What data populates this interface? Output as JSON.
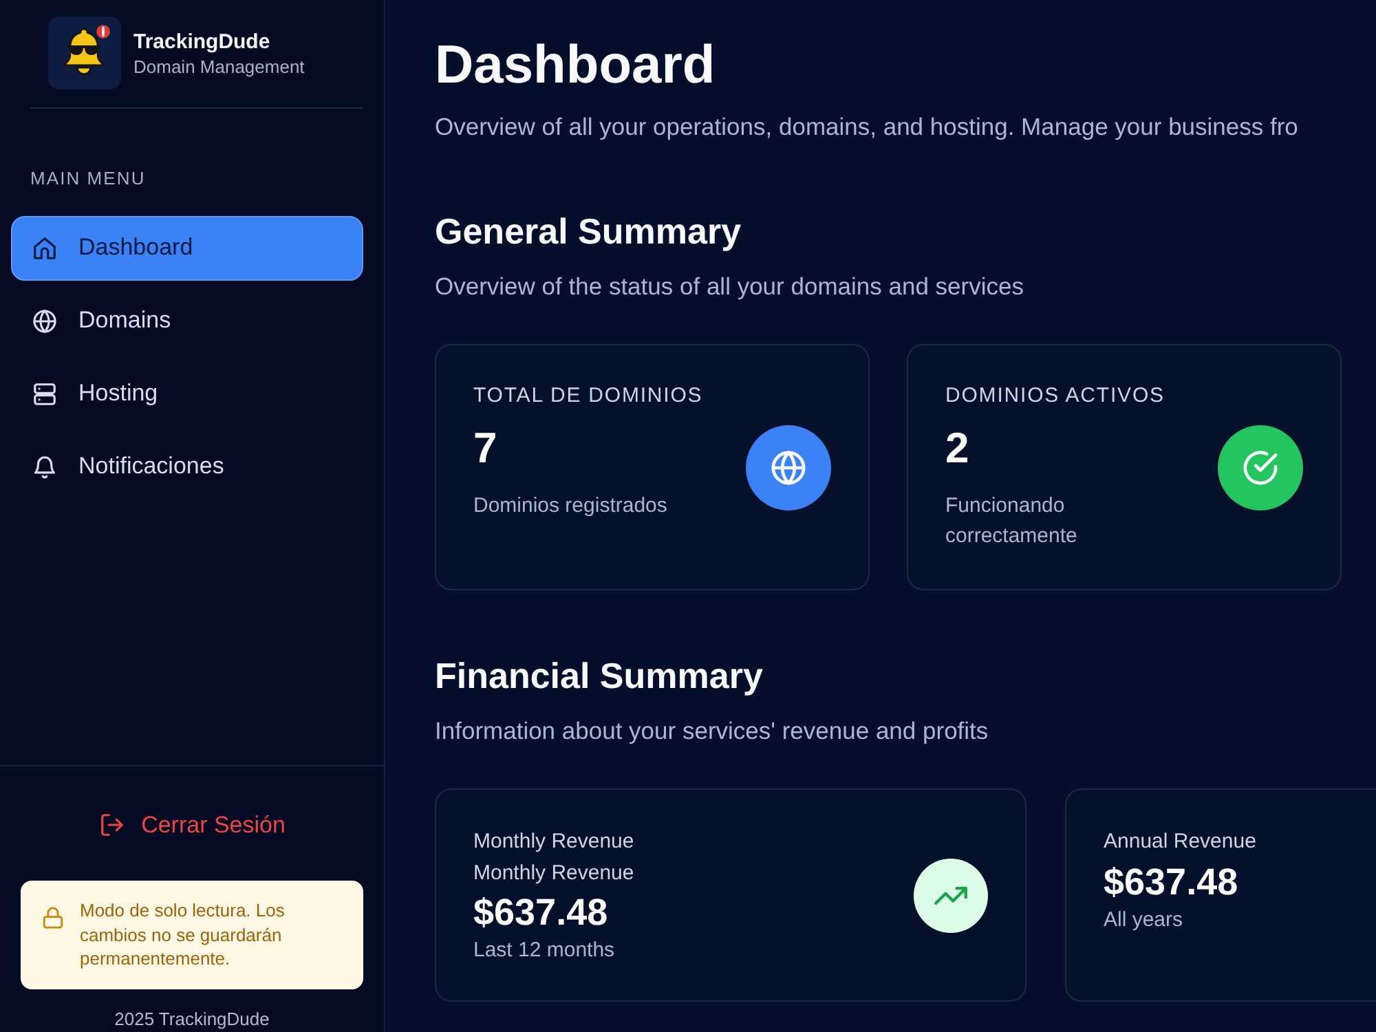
{
  "sidebar": {
    "brand": {
      "name": "TrackingDude",
      "tagline": "Domain Management"
    },
    "section_label": "MAIN MENU",
    "nav_items": [
      {
        "label": "Dashboard",
        "selected": true
      },
      {
        "label": "Domains",
        "selected": false
      },
      {
        "label": "Hosting",
        "selected": false
      },
      {
        "label": "Notificaciones",
        "selected": false
      }
    ],
    "logout": {
      "label": "Cerrar Sesión"
    },
    "notice": {
      "text": "Modo de solo lectura. Los cambios no se guardarán permanentemente."
    },
    "footer": "2025 TrackingDude"
  },
  "page": {
    "title": "Dashboard",
    "subtitle": "Overview of all your operations, domains, and hosting. Manage your business fro"
  },
  "sections": [
    {
      "title": "General Summary",
      "subtitle": "Overview of the status of all your domains and services",
      "kind": "status",
      "cards": [
        {
          "label": "TOTAL DE DOMINIOS",
          "value": "7",
          "description": "Dominios registrados",
          "color": "#3b82f6"
        },
        {
          "label": "DOMINIOS ACTIVOS",
          "value": "2",
          "description": "Funcionando correctamente",
          "color": "#22c55e"
        }
      ]
    },
    {
      "title": "Financial Summary",
      "subtitle": "Information about your services' revenue and profits",
      "kind": "finance",
      "cards": [
        {
          "labels": [
            "Monthly Revenue",
            "Monthly Revenue"
          ],
          "value": "$637.48",
          "description": "Last 12 months"
        },
        {
          "labels": [
            "Annual Revenue"
          ],
          "value": "$637.48",
          "description": "All years"
        }
      ]
    }
  ]
}
